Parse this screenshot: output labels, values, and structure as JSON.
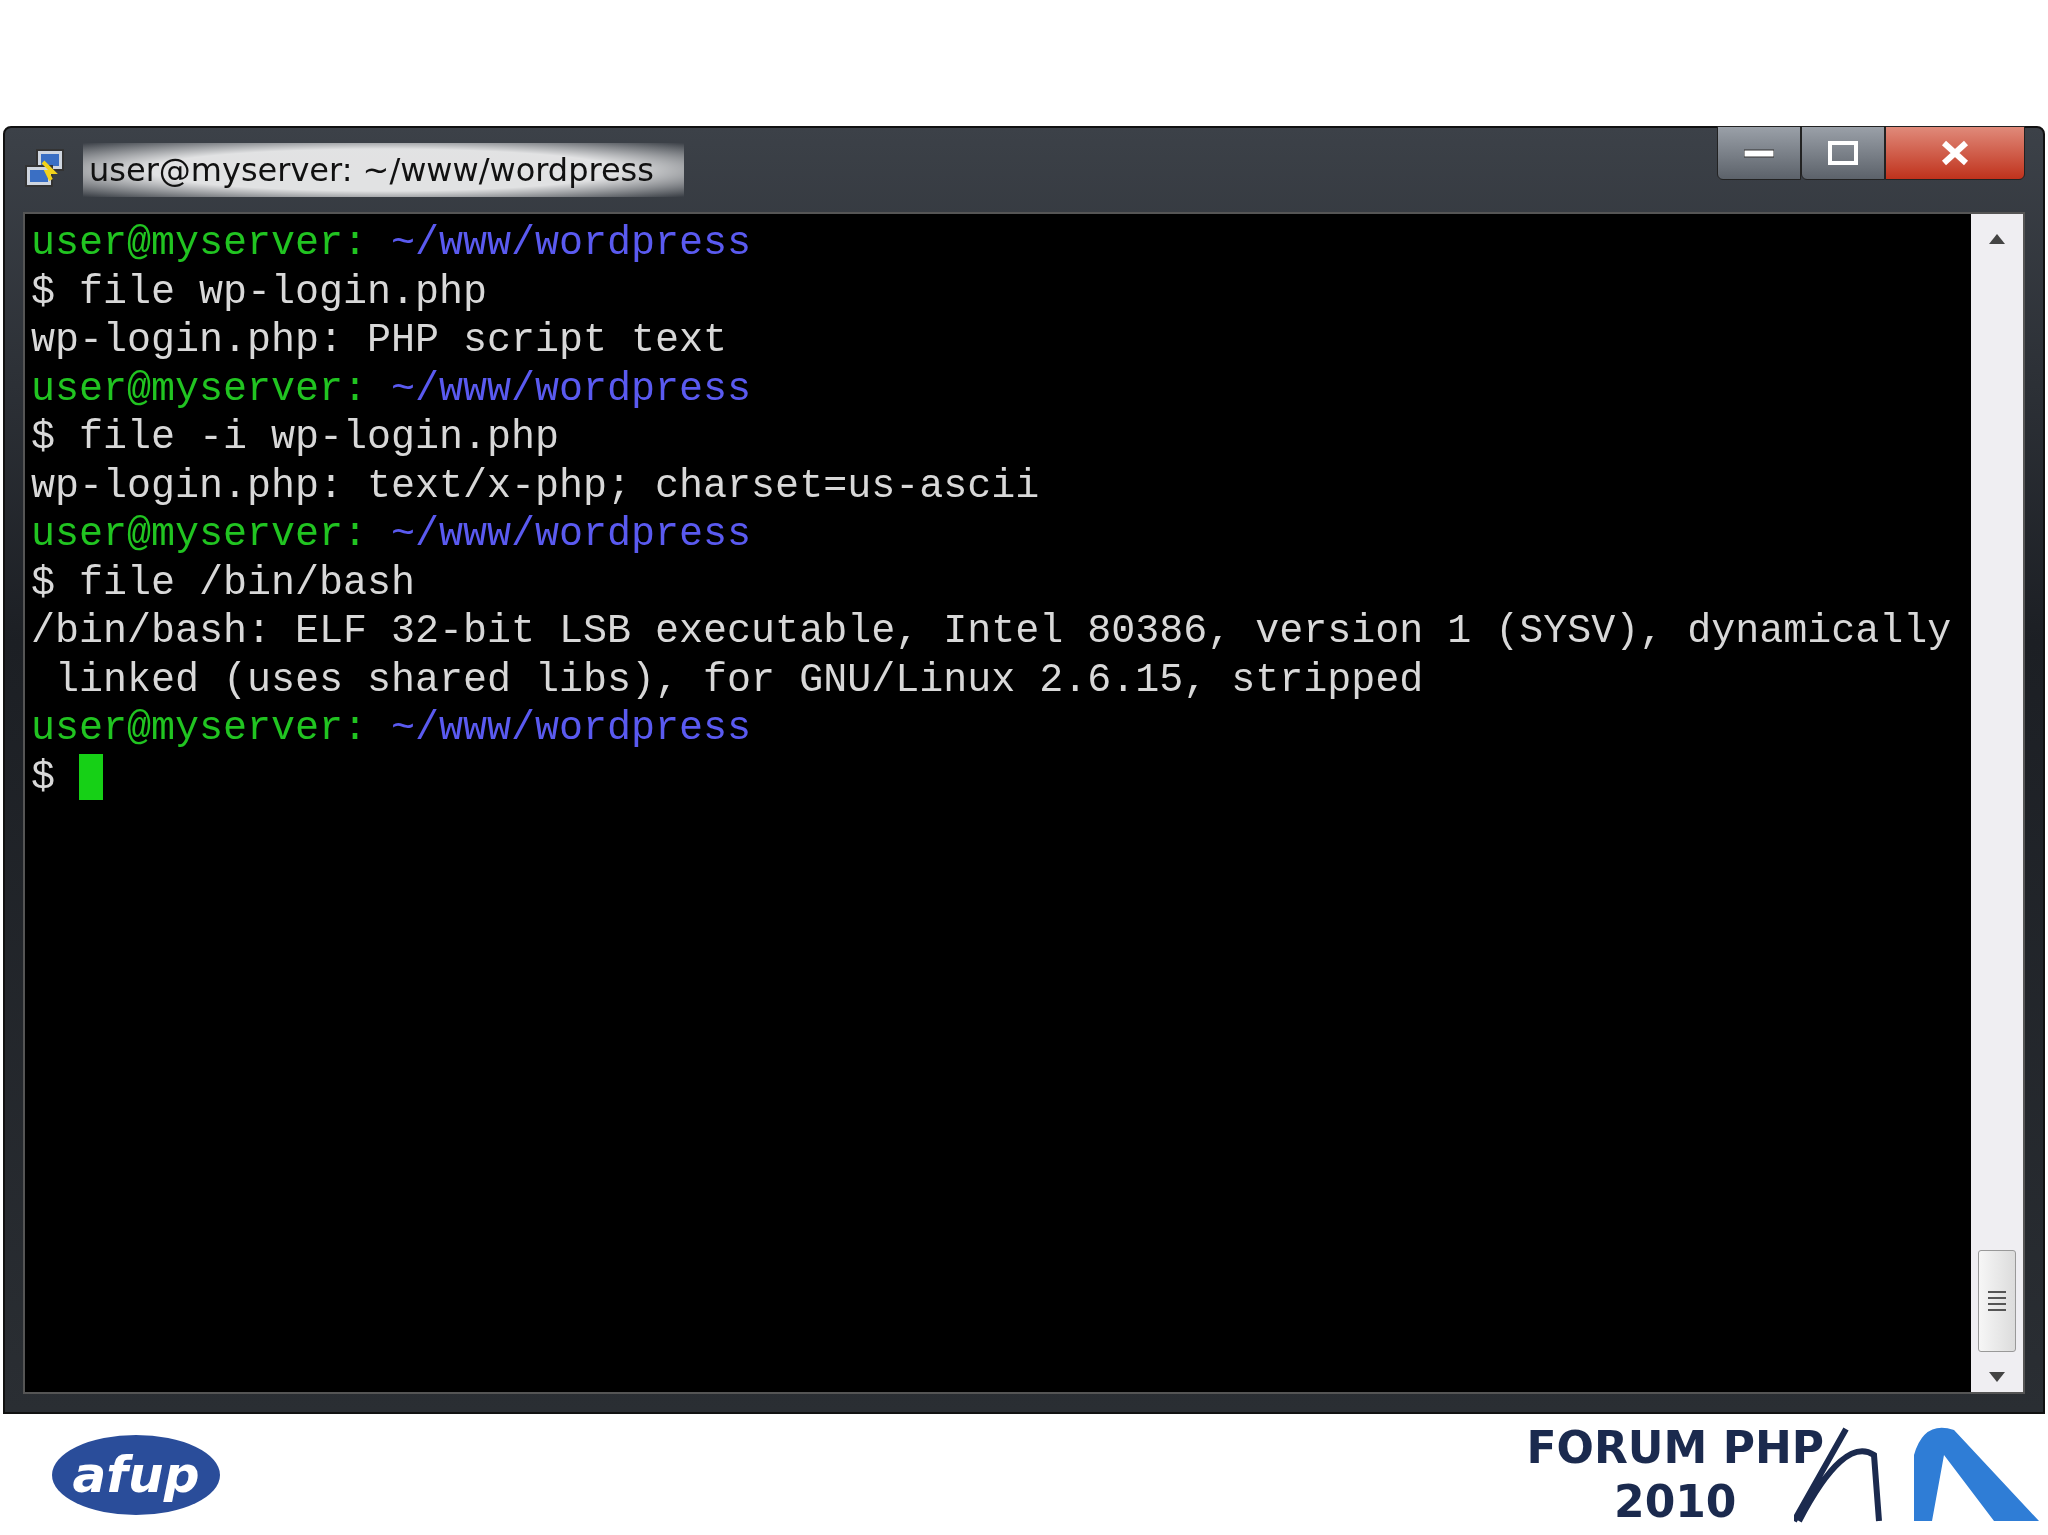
{
  "window": {
    "title": "user@myserver: ~/www/wordpress"
  },
  "terminal": {
    "lines": [
      {
        "kind": "prompt",
        "user": "user@myserver:",
        "path": "~/www/wordpress"
      },
      {
        "kind": "command",
        "prompt": "$",
        "text": "file wp-login.php"
      },
      {
        "kind": "output",
        "text": "wp-login.php: PHP script text"
      },
      {
        "kind": "prompt",
        "user": "user@myserver:",
        "path": "~/www/wordpress"
      },
      {
        "kind": "command",
        "prompt": "$",
        "text": "file -i wp-login.php"
      },
      {
        "kind": "output",
        "text": "wp-login.php: text/x-php; charset=us-ascii"
      },
      {
        "kind": "prompt",
        "user": "user@myserver:",
        "path": "~/www/wordpress"
      },
      {
        "kind": "command",
        "prompt": "$",
        "text": "file /bin/bash"
      },
      {
        "kind": "output",
        "text": "/bin/bash: ELF 32-bit LSB executable, Intel 80386, version 1 (SYSV), dynamically"
      },
      {
        "kind": "output",
        "text": " linked (uses shared libs), for GNU/Linux 2.6.15, stripped"
      },
      {
        "kind": "prompt",
        "user": "user@myserver:",
        "path": "~/www/wordpress"
      },
      {
        "kind": "cursor",
        "prompt": "$"
      }
    ]
  },
  "footer": {
    "left_logo": "afup",
    "event_name": "FORUM PHP",
    "event_year": "2010"
  }
}
